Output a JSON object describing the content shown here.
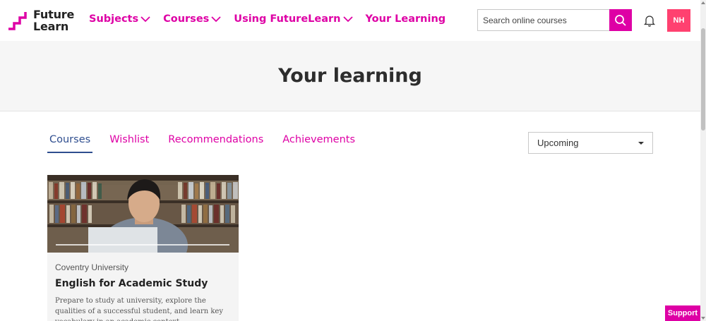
{
  "brand": {
    "logo_line1": "Future",
    "logo_line2": "Learn",
    "accent": "#de00a5"
  },
  "nav": {
    "subjects": "Subjects",
    "courses": "Courses",
    "using": "Using FutureLearn",
    "your_learning": "Your Learning"
  },
  "search": {
    "placeholder": "Search online courses"
  },
  "user": {
    "initials": "NH"
  },
  "page": {
    "title": "Your learning"
  },
  "tabs": [
    "Courses",
    "Wishlist",
    "Recommendations",
    "Achievements"
  ],
  "filter": {
    "selected": "Upcoming"
  },
  "course": {
    "provider": "Coventry University",
    "title": "English for Academic Study",
    "description": "Prepare to study at university, explore the qualities of a successful student, and learn key vocabulary in an academic context."
  },
  "support": {
    "label": "Support"
  }
}
